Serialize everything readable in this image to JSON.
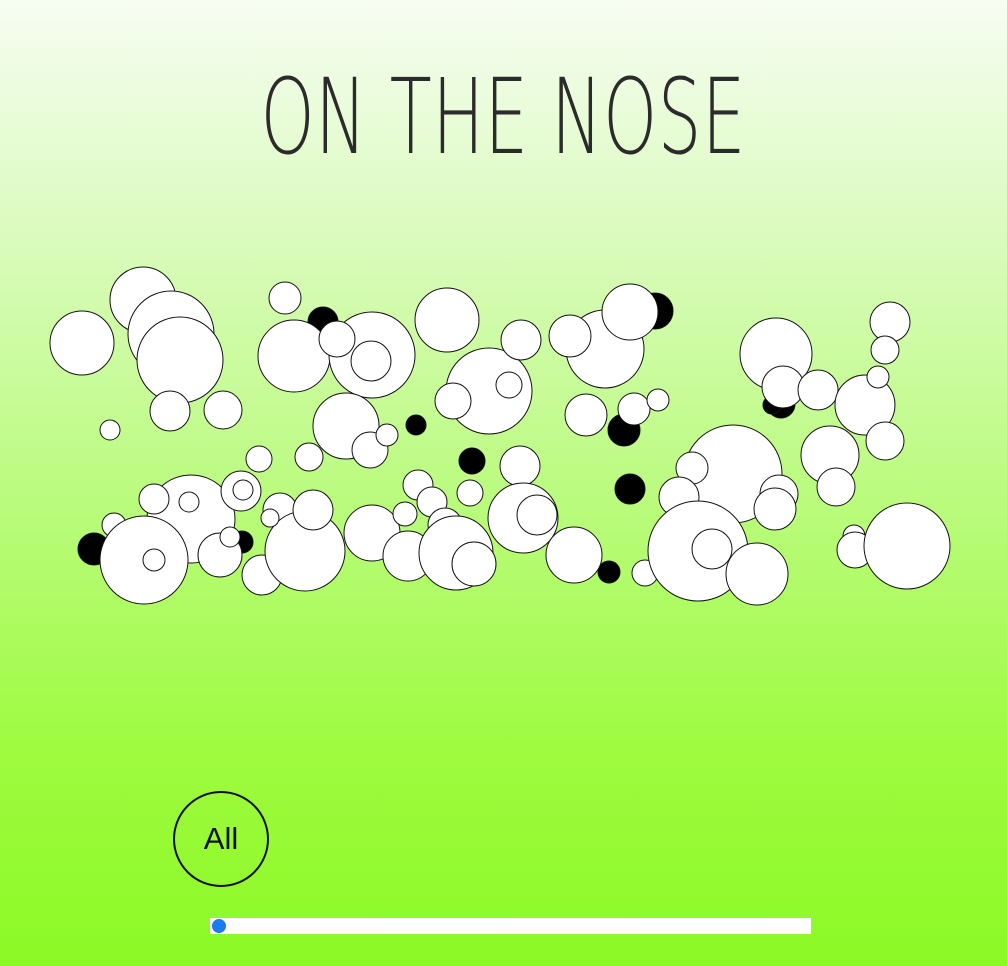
{
  "title": "ON THE NOSE",
  "filter": {
    "label": "All"
  },
  "timeline": {
    "value": 0
  },
  "colors": {
    "bubble_fill": "#ffffff",
    "bubble_dark": "#000000",
    "bubble_stroke": "#111111",
    "slider_thumb": "#1a7cf5",
    "slider_track": "#ffffff"
  }
}
